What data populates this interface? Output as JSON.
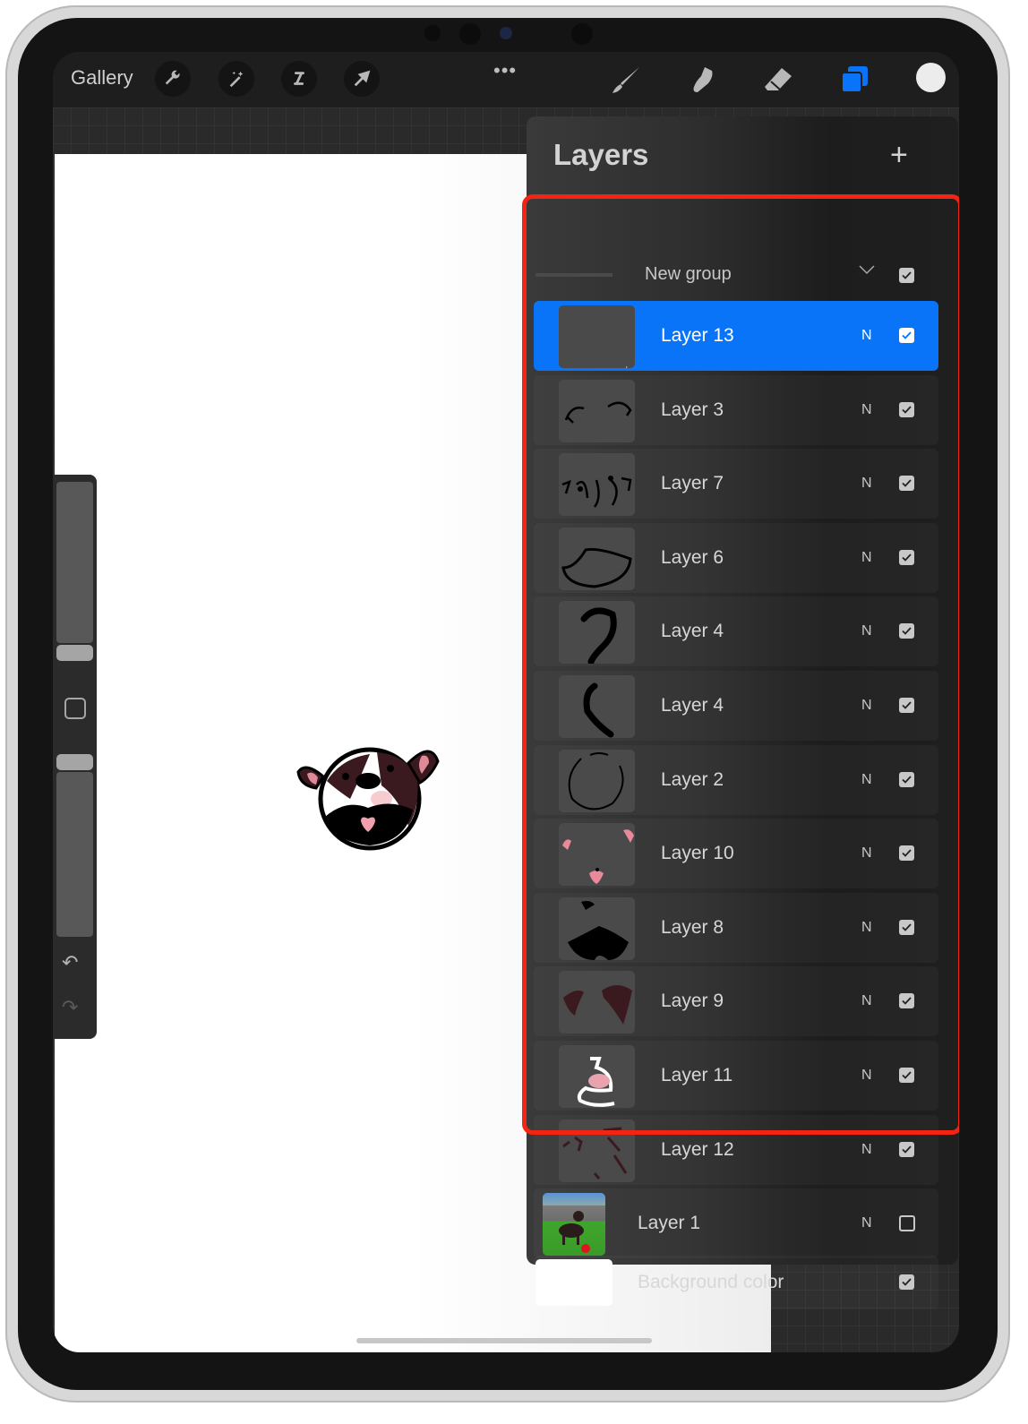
{
  "toolbar": {
    "gallery_label": "Gallery",
    "left_tools": [
      "wrench-icon",
      "magic-wand-icon",
      "selection-icon",
      "transform-arrow-icon"
    ],
    "more_label": "•••",
    "right_tools": [
      "brush-icon",
      "smudge-icon",
      "eraser-icon",
      "layers-icon"
    ],
    "active_tool": "layers-icon",
    "current_color": "#ececec",
    "accent_color": "#0a74f8"
  },
  "layers_panel": {
    "title": "Layers",
    "add_label": "+",
    "group": {
      "name": "New group",
      "expanded": true,
      "visible": true
    },
    "layers": [
      {
        "name": "Layer 13",
        "blend": "N",
        "visible": true,
        "selected": true,
        "in_group": true
      },
      {
        "name": "Layer 3",
        "blend": "N",
        "visible": true,
        "selected": false,
        "in_group": true
      },
      {
        "name": "Layer 7",
        "blend": "N",
        "visible": true,
        "selected": false,
        "in_group": true
      },
      {
        "name": "Layer 6",
        "blend": "N",
        "visible": true,
        "selected": false,
        "in_group": true
      },
      {
        "name": "Layer 4",
        "blend": "N",
        "visible": true,
        "selected": false,
        "in_group": true
      },
      {
        "name": "Layer 4",
        "blend": "N",
        "visible": true,
        "selected": false,
        "in_group": true
      },
      {
        "name": "Layer 2",
        "blend": "N",
        "visible": true,
        "selected": false,
        "in_group": true
      },
      {
        "name": "Layer 10",
        "blend": "N",
        "visible": true,
        "selected": false,
        "in_group": true
      },
      {
        "name": "Layer 8",
        "blend": "N",
        "visible": true,
        "selected": false,
        "in_group": true
      },
      {
        "name": "Layer 9",
        "blend": "N",
        "visible": true,
        "selected": false,
        "in_group": true
      },
      {
        "name": "Layer 11",
        "blend": "N",
        "visible": true,
        "selected": false,
        "in_group": true
      },
      {
        "name": "Layer 12",
        "blend": "N",
        "visible": true,
        "selected": false,
        "in_group": true
      },
      {
        "name": "Layer 1",
        "blend": "N",
        "visible": false,
        "selected": false,
        "in_group": false
      }
    ],
    "background": {
      "name": "Background color",
      "visible": true,
      "color": "#ffffff"
    },
    "highlight_color": "#f32411"
  },
  "sidebar": {
    "undo_label": "↶",
    "redo_label": "↷",
    "brush_size": 0.22,
    "opacity": 1.0
  }
}
